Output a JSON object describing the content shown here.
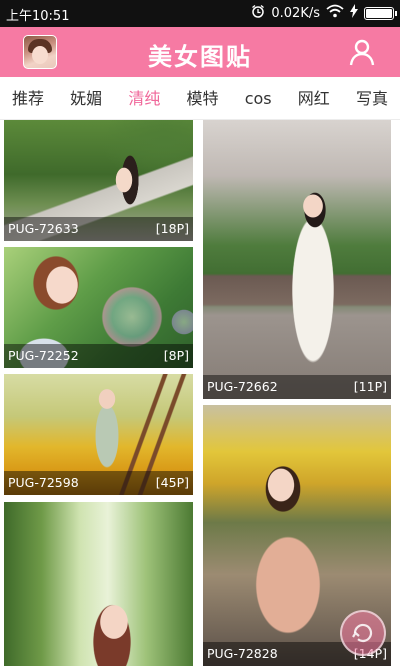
{
  "status_bar": {
    "time": "上午10:51",
    "network_speed": "0.02K/s",
    "icons": [
      "alarm-icon",
      "wifi-icon",
      "charging-icon",
      "battery-icon"
    ]
  },
  "header": {
    "title": "美女图贴",
    "avatar_icon": "avatar",
    "user_icon": "user-icon",
    "brand_color": "#f67aa3"
  },
  "tabs": {
    "items": [
      "推荐",
      "妩媚",
      "清纯",
      "模特",
      "cos",
      "网红",
      "写真"
    ],
    "active": "清纯",
    "active_color": "#f0679a"
  },
  "gallery": {
    "left": [
      {
        "id": "PUG-72633",
        "count": "[18P]"
      },
      {
        "id": "PUG-72252",
        "count": "[8P]"
      },
      {
        "id": "PUG-72598",
        "count": "[45P]"
      },
      {
        "id": "",
        "count": ""
      }
    ],
    "right": [
      {
        "id": "PUG-72662",
        "count": "[11P]"
      },
      {
        "id": "PUG-72828",
        "count": "[14P]"
      }
    ]
  },
  "floating_button_icon": "refresh-icon"
}
